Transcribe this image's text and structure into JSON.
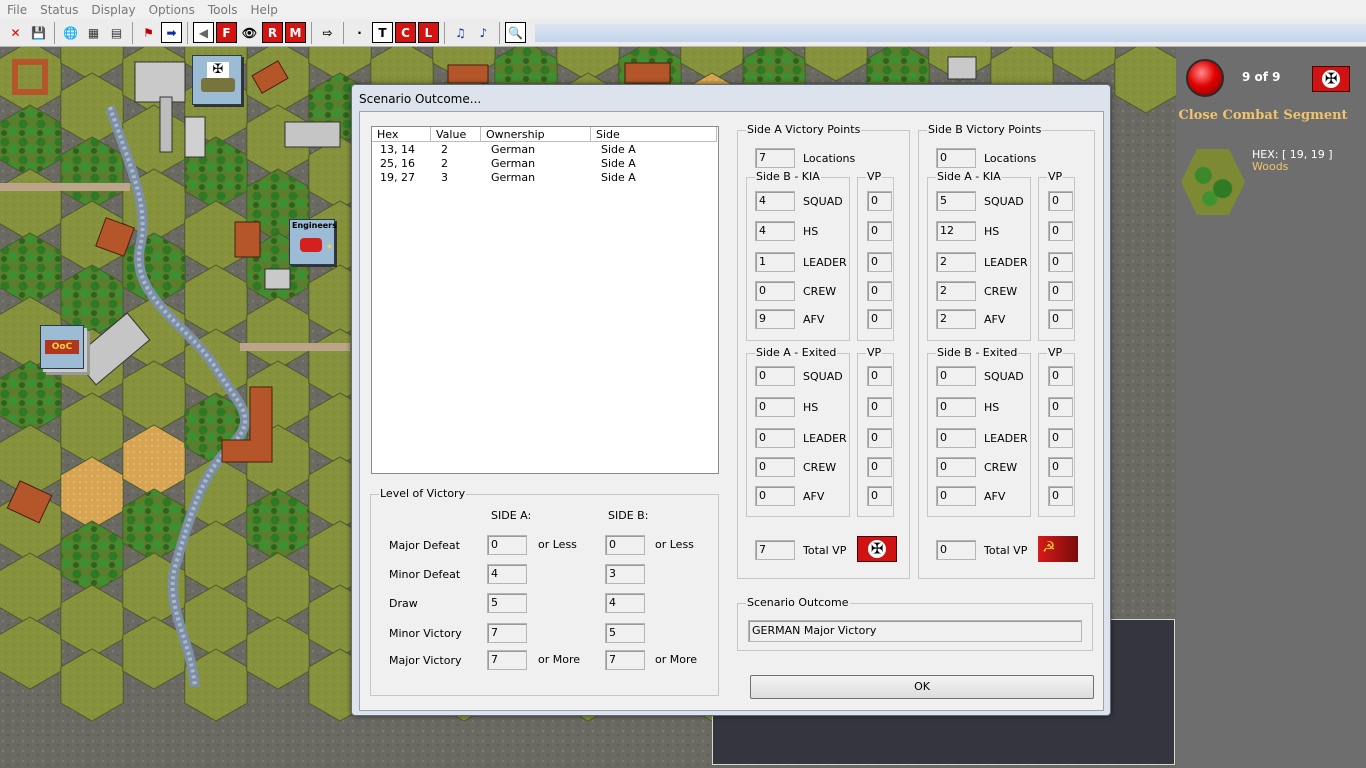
{
  "menu": [
    "File",
    "Status",
    "Display",
    "Options",
    "Tools",
    "Help"
  ],
  "toolbar": {
    "buttons": [
      {
        "name": "close-icon",
        "glyph": "✕",
        "style": "plain",
        "color": "#e00000"
      },
      {
        "name": "save-icon",
        "glyph": "💾",
        "style": "plain",
        "color": "#000000"
      },
      {
        "sep": true
      },
      {
        "name": "globe-icon",
        "glyph": "🌐",
        "style": "plain",
        "color": "#1a7bd1"
      },
      {
        "name": "counters-icon",
        "glyph": "▦",
        "style": "plain",
        "color": "#333333"
      },
      {
        "name": "stack-icon",
        "glyph": "▤",
        "style": "plain",
        "color": "#333333"
      },
      {
        "sep": true
      },
      {
        "name": "unit-info-icon",
        "glyph": "⚑",
        "style": "plain",
        "color": "#c00000"
      },
      {
        "name": "next-unit-icon",
        "glyph": "➡",
        "style": "sq",
        "color": "#0b2ea8"
      },
      {
        "sep": true
      },
      {
        "name": "prev-icon",
        "glyph": "◀",
        "style": "sq",
        "color": "#666666"
      },
      {
        "name": "fire-icon",
        "glyph": "F",
        "style": "red",
        "color": "#ffffff"
      },
      {
        "name": "eye-icon",
        "glyph": "👁",
        "style": "plain",
        "color": "#000000"
      },
      {
        "name": "rally-icon",
        "glyph": "R",
        "style": "red",
        "color": "#ffffff"
      },
      {
        "name": "morale-icon",
        "glyph": "M",
        "style": "red",
        "color": "#ffffff"
      },
      {
        "sep": true
      },
      {
        "name": "next-phase-icon",
        "glyph": "⇨",
        "style": "plain",
        "color": "#000000"
      },
      {
        "sep": true
      },
      {
        "name": "dot-icon",
        "glyph": "·",
        "style": "plain",
        "color": "#000000"
      },
      {
        "name": "text-icon",
        "glyph": "T",
        "style": "sq",
        "color": "#000000"
      },
      {
        "name": "c-icon",
        "glyph": "C",
        "style": "red",
        "color": "#ffffff"
      },
      {
        "name": "l-icon",
        "glyph": "L",
        "style": "red",
        "color": "#ffffff"
      },
      {
        "sep": true
      },
      {
        "name": "sound-fx-icon",
        "glyph": "♫",
        "style": "plain",
        "color": "#1133aa"
      },
      {
        "name": "music-icon",
        "glyph": "♪",
        "style": "plain",
        "color": "#1133aa"
      },
      {
        "sep": true
      },
      {
        "name": "zoom-icon",
        "glyph": "🔍",
        "style": "sq",
        "color": "#000000"
      }
    ]
  },
  "map": {
    "counter_engineers": "Engineers",
    "counter_ooc": "OoC"
  },
  "hud": {
    "turn": "9 of 9",
    "phase": "Close Combat Segment",
    "hex_coord": "HEX: [ 19, 19 ]",
    "hex_terrain": "Woods"
  },
  "dialog": {
    "title": "Scenario Outcome...",
    "list": {
      "headers": [
        "Hex",
        "Value",
        "Ownership",
        "Side"
      ],
      "rows": [
        [
          "13, 14",
          "2",
          "German",
          "Side A"
        ],
        [
          "25, 16",
          "2",
          "German",
          "Side A"
        ],
        [
          "19, 27",
          "3",
          "German",
          "Side A"
        ]
      ]
    },
    "victory_levels": {
      "group_label": "Level of Victory",
      "side_a_label": "SIDE A:",
      "side_b_label": "SIDE B:",
      "rows": [
        {
          "label": "Major Defeat",
          "a": "0",
          "a_suffix": "or Less",
          "b": "0",
          "b_suffix": "or Less"
        },
        {
          "label": "Minor Defeat",
          "a": "4",
          "a_suffix": "",
          "b": "3",
          "b_suffix": ""
        },
        {
          "label": "Draw",
          "a": "5",
          "a_suffix": "",
          "b": "4",
          "b_suffix": ""
        },
        {
          "label": "Minor Victory",
          "a": "7",
          "a_suffix": "",
          "b": "5",
          "b_suffix": ""
        },
        {
          "label": "Major Victory",
          "a": "7",
          "a_suffix": "or More",
          "b": "7",
          "b_suffix": "or More"
        }
      ]
    },
    "side_a": {
      "group_label": "Side A Victory Points",
      "locations_value": "7",
      "locations_label": "Locations",
      "kia_label": "Side B - KIA",
      "exited_label": "Side A - Exited",
      "vp_label": "VP",
      "kia": [
        {
          "label": "SQUAD",
          "value": "4",
          "vp": "0"
        },
        {
          "label": "HS",
          "value": "4",
          "vp": "0"
        },
        {
          "label": "LEADER",
          "value": "1",
          "vp": "0"
        },
        {
          "label": "CREW",
          "value": "0",
          "vp": "0"
        },
        {
          "label": "AFV",
          "value": "9",
          "vp": "0"
        }
      ],
      "exited": [
        {
          "label": "SQUAD",
          "value": "0",
          "vp": "0"
        },
        {
          "label": "HS",
          "value": "0",
          "vp": "0"
        },
        {
          "label": "LEADER",
          "value": "0",
          "vp": "0"
        },
        {
          "label": "CREW",
          "value": "0",
          "vp": "0"
        },
        {
          "label": "AFV",
          "value": "0",
          "vp": "0"
        }
      ],
      "total_value": "7",
      "total_label": "Total VP",
      "flag": "german-flag-icon"
    },
    "side_b": {
      "group_label": "Side B Victory Points",
      "locations_value": "0",
      "locations_label": "Locations",
      "kia_label": "Side A - KIA",
      "exited_label": "Side B - Exited",
      "vp_label": "VP",
      "kia": [
        {
          "label": "SQUAD",
          "value": "5",
          "vp": "0"
        },
        {
          "label": "HS",
          "value": "12",
          "vp": "0"
        },
        {
          "label": "LEADER",
          "value": "2",
          "vp": "0"
        },
        {
          "label": "CREW",
          "value": "2",
          "vp": "0"
        },
        {
          "label": "AFV",
          "value": "2",
          "vp": "0"
        }
      ],
      "exited": [
        {
          "label": "SQUAD",
          "value": "0",
          "vp": "0"
        },
        {
          "label": "HS",
          "value": "0",
          "vp": "0"
        },
        {
          "label": "LEADER",
          "value": "0",
          "vp": "0"
        },
        {
          "label": "CREW",
          "value": "0",
          "vp": "0"
        },
        {
          "label": "AFV",
          "value": "0",
          "vp": "0"
        }
      ],
      "total_value": "0",
      "total_label": "Total VP",
      "flag": "soviet-flag-icon"
    },
    "outcome": {
      "group_label": "Scenario Outcome",
      "text": "GERMAN Major Victory"
    },
    "ok_label": "OK"
  }
}
